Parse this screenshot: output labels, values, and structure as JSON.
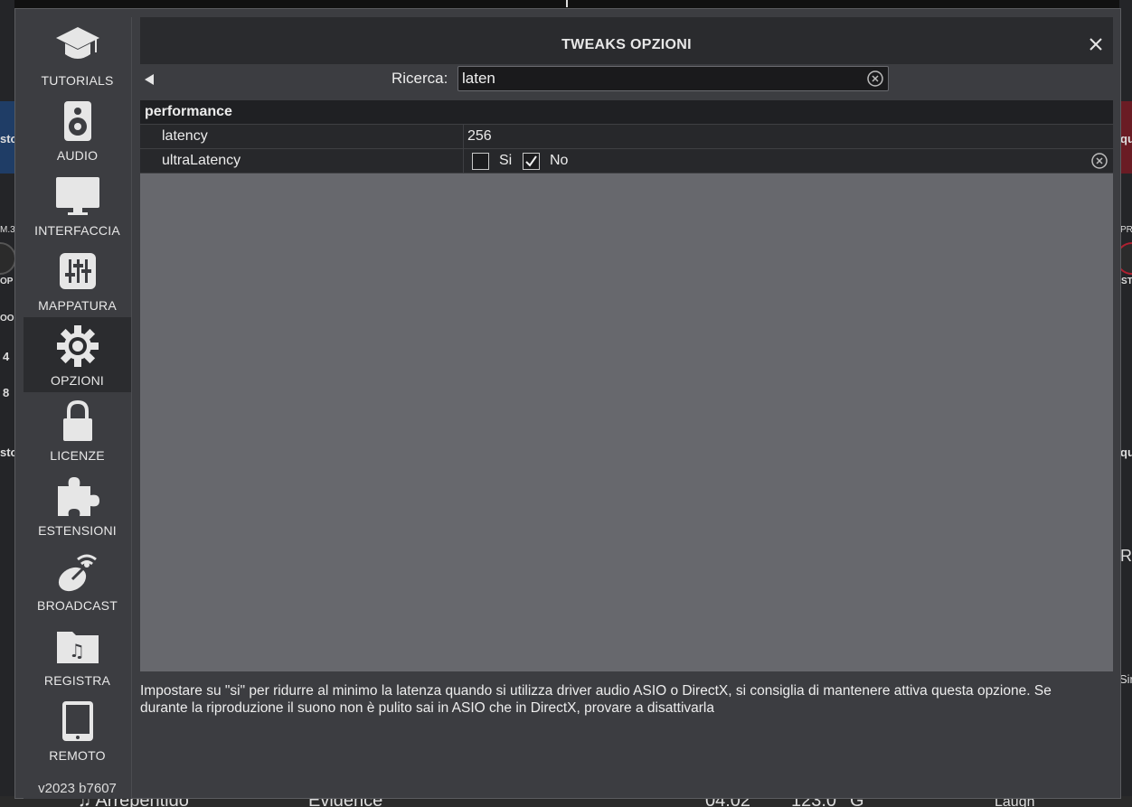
{
  "dialog": {
    "title": "TWEAKS OPZIONI",
    "close_icon": "close-icon"
  },
  "sidebar": {
    "items": [
      {
        "label": "TUTORIALS",
        "icon": "graduation-cap-icon"
      },
      {
        "label": "AUDIO",
        "icon": "speaker-icon"
      },
      {
        "label": "INTERFACCIA",
        "icon": "monitor-icon"
      },
      {
        "label": "MAPPATURA",
        "icon": "sliders-icon"
      },
      {
        "label": "OPZIONI",
        "icon": "gear-icon",
        "active": true
      },
      {
        "label": "LICENZE",
        "icon": "lock-icon"
      },
      {
        "label": "ESTENSIONI",
        "icon": "puzzle-icon"
      },
      {
        "label": "BROADCAST",
        "icon": "satellite-dish-icon"
      },
      {
        "label": "REGISTRA",
        "icon": "music-folder-icon"
      },
      {
        "label": "REMOTO",
        "icon": "tablet-icon"
      }
    ],
    "version": "v2023 b7607"
  },
  "search": {
    "label": "Ricerca:",
    "value": "laten"
  },
  "table": {
    "group": "performance",
    "rows": [
      {
        "name": "latency",
        "value": "256"
      },
      {
        "name": "ultraLatency",
        "options": [
          {
            "label": "Si",
            "checked": false
          },
          {
            "label": "No",
            "checked": true
          }
        ]
      }
    ]
  },
  "description": "Impostare su \"si\" per ridurre al minimo la latenza quando si utilizza driver audio ASIO o DirectX, si consiglia di mantenere attiva questa opzione. Se durante la riproduzione il suono non è pulito sai in ASIO che in DirectX, provare a disattivarla",
  "background": {
    "left_texts": [
      "sto",
      "M.3",
      "OP",
      "OOI",
      "4",
      "8",
      "sto"
    ],
    "right_texts": [
      "qu",
      "PRI",
      "ST",
      "qu",
      "R",
      "Sir"
    ],
    "bottom_texts": [
      "♫ Arrepentido",
      "Evidence",
      "04:02",
      "123.0",
      "G",
      "Laugh"
    ]
  },
  "colors": {
    "dialog_bg": "#3c3d41",
    "header_bg": "#2a2b2e",
    "table_empty_bg": "#67686d",
    "row_bg": "#27282b",
    "active_nav_bg": "#2b2c2f"
  }
}
